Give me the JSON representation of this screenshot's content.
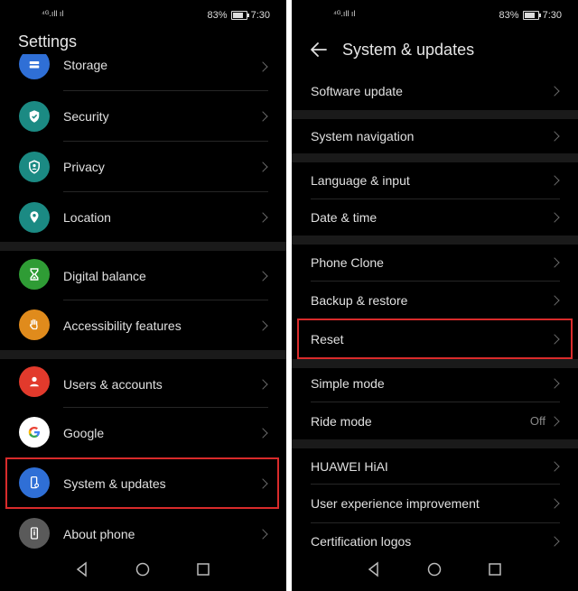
{
  "status": {
    "signal": "⁴ᴳ.ıll ıl",
    "battery": "83%",
    "time": "7:30"
  },
  "left": {
    "title": "Settings",
    "items": [
      {
        "label": "Storage",
        "icon": "storage-icon",
        "color": "#2f6fd6"
      },
      {
        "label": "Security",
        "icon": "shield-icon",
        "color": "#1b8a83"
      },
      {
        "label": "Privacy",
        "icon": "privacy-icon",
        "color": "#1b8a83"
      },
      {
        "label": "Location",
        "icon": "location-pin-icon",
        "color": "#1b8a83"
      },
      {
        "label": "Digital balance",
        "icon": "hourglass-icon",
        "color": "#2f9c35"
      },
      {
        "label": "Accessibility features",
        "icon": "hand-icon",
        "color": "#e08b1c"
      },
      {
        "label": "Users & accounts",
        "icon": "user-icon",
        "color": "#e23a2c"
      },
      {
        "label": "Google",
        "icon": "google-icon",
        "color": "#ffffff"
      },
      {
        "label": "System & updates",
        "icon": "phone-settings-icon",
        "color": "#2f6fd6"
      },
      {
        "label": "About phone",
        "icon": "info-icon",
        "color": "#5a5a5a"
      }
    ]
  },
  "right": {
    "title": "System & updates",
    "items": [
      {
        "label": "Software update"
      },
      {
        "label": "System navigation"
      },
      {
        "label": "Language & input"
      },
      {
        "label": "Date & time"
      },
      {
        "label": "Phone Clone"
      },
      {
        "label": "Backup & restore"
      },
      {
        "label": "Reset"
      },
      {
        "label": "Simple mode"
      },
      {
        "label": "Ride mode",
        "value": "Off"
      },
      {
        "label": "HUAWEI HiAI"
      },
      {
        "label": "User experience improvement"
      },
      {
        "label": "Certification logos"
      }
    ]
  },
  "colors": {
    "highlight": "#d92b2b",
    "background": "#000000"
  }
}
